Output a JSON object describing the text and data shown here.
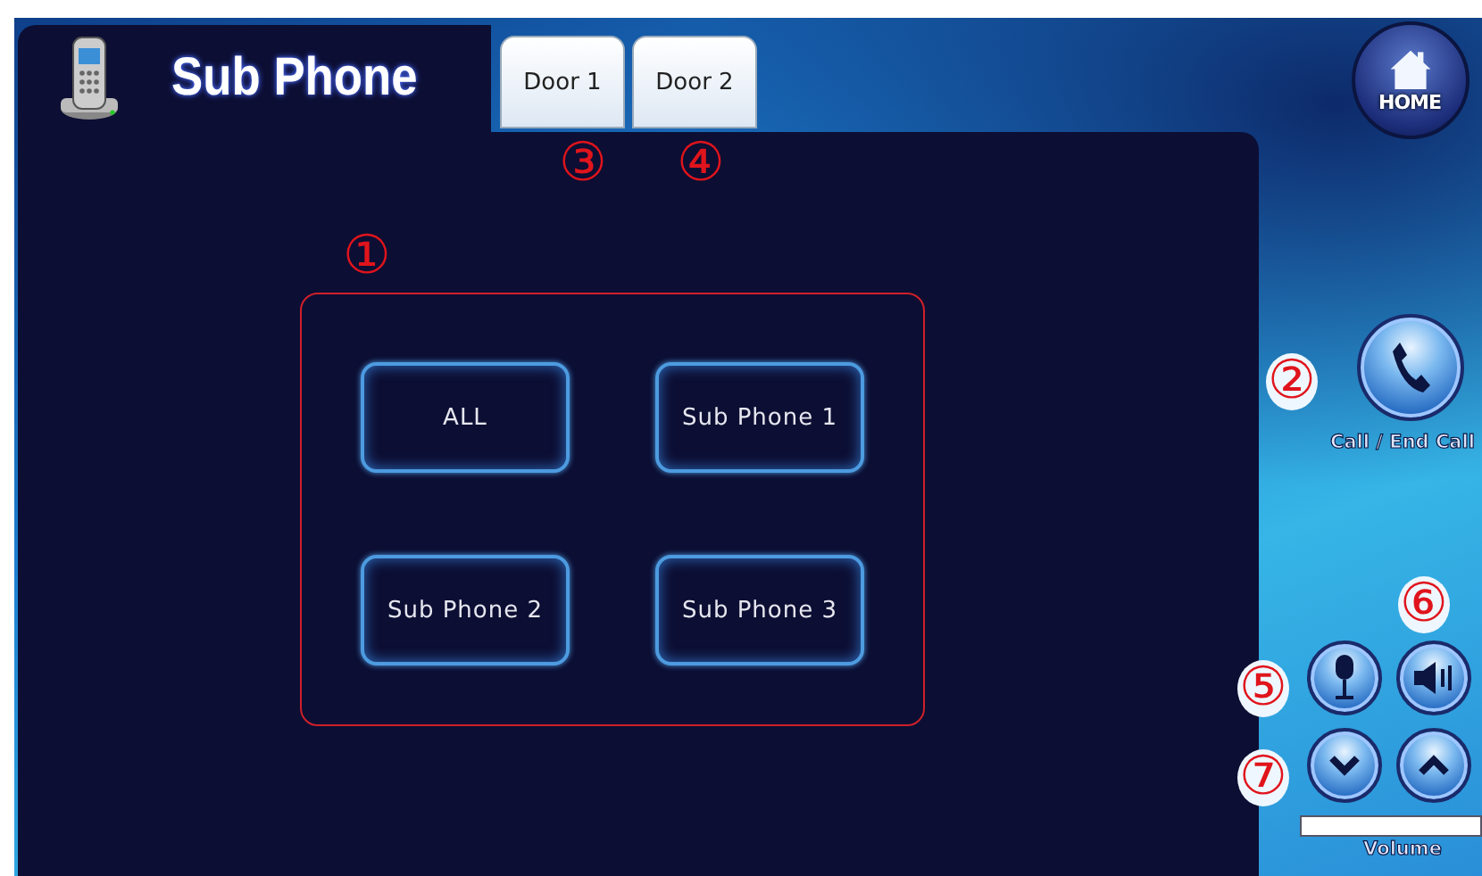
{
  "header": {
    "title": "Sub Phone"
  },
  "tabs": [
    {
      "label": "Door 1",
      "annotation": "③"
    },
    {
      "label": "Door 2",
      "annotation": "④"
    }
  ],
  "phone_group": {
    "annotation": "①",
    "buttons": [
      "ALL",
      "Sub Phone 1",
      "Sub Phone 2",
      "Sub Phone 3"
    ]
  },
  "side": {
    "home": "HOME",
    "call": {
      "label": "Call / End Call",
      "annotation": "②"
    },
    "mic": {
      "annotation": "⑤"
    },
    "speaker": {
      "annotation": "⑥"
    },
    "volume_down": {
      "annotation": "⑦"
    },
    "volume_label": "Volume"
  }
}
